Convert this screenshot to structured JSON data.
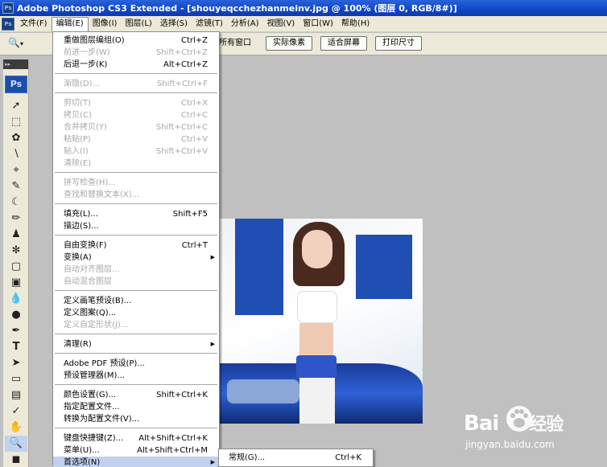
{
  "window": {
    "title": "Adobe Photoshop CS3 Extended - [shouyeqcchezhanmeinv.jpg @ 100% (图层 0, RGB/8#)]",
    "app_icon": "Ps"
  },
  "menubar": {
    "items": [
      "文件(F)",
      "编辑(E)",
      "图像(I)",
      "图层(L)",
      "选择(S)",
      "滤镜(T)",
      "分析(A)",
      "视图(V)",
      "窗口(W)",
      "帮助(H)"
    ],
    "active": "编辑(E)"
  },
  "options_bar": {
    "fragment": "所有窗口",
    "buttons": [
      "实际像素",
      "适合屏幕",
      "打印尺寸"
    ]
  },
  "toolbox": {
    "logo": "Ps",
    "grip": "▸▸"
  },
  "edit_menu": {
    "groups": [
      [
        {
          "label": "重做图层编组(O)",
          "shortcut": "Ctrl+Z",
          "enabled": true
        },
        {
          "label": "前进一步(W)",
          "shortcut": "Shift+Ctrl+Z",
          "enabled": false
        },
        {
          "label": "后退一步(K)",
          "shortcut": "Alt+Ctrl+Z",
          "enabled": true
        }
      ],
      [
        {
          "label": "渐隐(D)...",
          "shortcut": "Shift+Ctrl+F",
          "enabled": false
        }
      ],
      [
        {
          "label": "剪切(T)",
          "shortcut": "Ctrl+X",
          "enabled": false
        },
        {
          "label": "拷贝(C)",
          "shortcut": "Ctrl+C",
          "enabled": false
        },
        {
          "label": "合并拷贝(Y)",
          "shortcut": "Shift+Ctrl+C",
          "enabled": false
        },
        {
          "label": "粘贴(P)",
          "shortcut": "Ctrl+V",
          "enabled": false
        },
        {
          "label": "贴入(I)",
          "shortcut": "Shift+Ctrl+V",
          "enabled": false
        },
        {
          "label": "清除(E)",
          "shortcut": "",
          "enabled": false
        }
      ],
      [
        {
          "label": "拼写检查(H)...",
          "shortcut": "",
          "enabled": false
        },
        {
          "label": "查找和替换文本(X)...",
          "shortcut": "",
          "enabled": false
        }
      ],
      [
        {
          "label": "填充(L)...",
          "shortcut": "Shift+F5",
          "enabled": true
        },
        {
          "label": "描边(S)...",
          "shortcut": "",
          "enabled": true
        }
      ],
      [
        {
          "label": "自由变换(F)",
          "shortcut": "Ctrl+T",
          "enabled": true
        },
        {
          "label": "变换(A)",
          "shortcut": "",
          "enabled": true,
          "submenu": true
        },
        {
          "label": "自动对齐图层...",
          "shortcut": "",
          "enabled": false
        },
        {
          "label": "自动混合图层",
          "shortcut": "",
          "enabled": false
        }
      ],
      [
        {
          "label": "定义画笔预设(B)...",
          "shortcut": "",
          "enabled": true
        },
        {
          "label": "定义图案(Q)...",
          "shortcut": "",
          "enabled": true
        },
        {
          "label": "定义自定形状(J)...",
          "shortcut": "",
          "enabled": false
        }
      ],
      [
        {
          "label": "清理(R)",
          "shortcut": "",
          "enabled": true,
          "submenu": true
        }
      ],
      [
        {
          "label": "Adobe PDF 预设(P)...",
          "shortcut": "",
          "enabled": true
        },
        {
          "label": "预设管理器(M)...",
          "shortcut": "",
          "enabled": true
        }
      ],
      [
        {
          "label": "颜色设置(G)...",
          "shortcut": "Shift+Ctrl+K",
          "enabled": true
        },
        {
          "label": "指定配置文件...",
          "shortcut": "",
          "enabled": true
        },
        {
          "label": "转换为配置文件(V)...",
          "shortcut": "",
          "enabled": true
        }
      ],
      [
        {
          "label": "键盘快捷键(Z)...",
          "shortcut": "Alt+Shift+Ctrl+K",
          "enabled": true
        },
        {
          "label": "菜单(U)...",
          "shortcut": "Alt+Shift+Ctrl+M",
          "enabled": true
        },
        {
          "label": "首选项(N)",
          "shortcut": "",
          "enabled": true,
          "submenu": true,
          "highlighted": true
        }
      ]
    ]
  },
  "preferences_submenu": {
    "label": "常规(G)...",
    "shortcut": "Ctrl+K"
  },
  "watermark": {
    "brand_left": "Bai",
    "brand_right": "经验",
    "url": "jingyan.baidu.com"
  }
}
